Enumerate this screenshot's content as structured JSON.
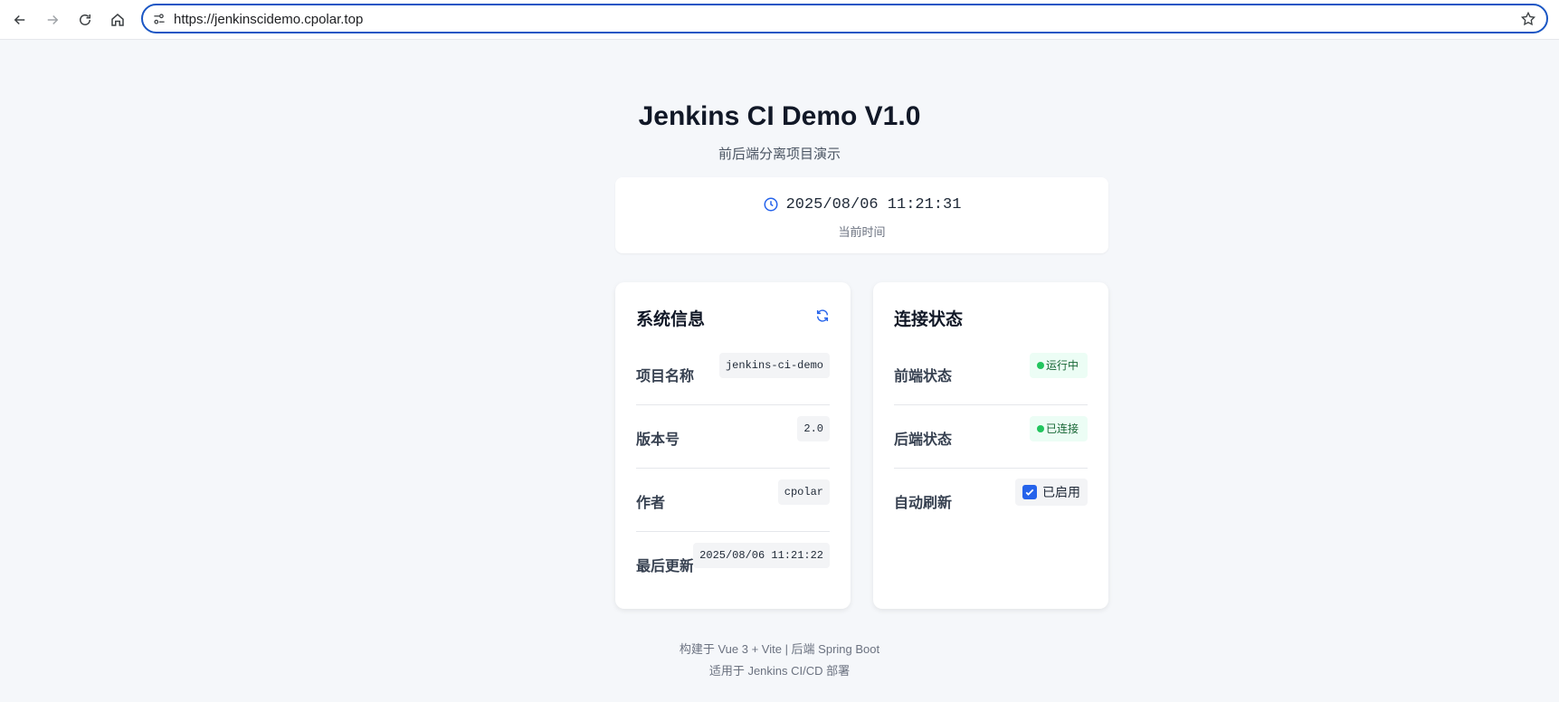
{
  "browser": {
    "url": "https://jenkinscidemo.cpolar.top",
    "icons": [
      "back-icon",
      "forward-icon",
      "reload-icon",
      "home-icon",
      "site-info-icon",
      "bookmark-star-icon"
    ]
  },
  "header": {
    "title": "Jenkins CI Demo V1.0",
    "subtitle": "前后端分离项目演示"
  },
  "clock": {
    "time": "2025/08/06 11:21:31",
    "label": "当前时间",
    "icon": "clock-icon"
  },
  "system_info": {
    "title": "系统信息",
    "refresh_icon": "refresh-icon",
    "rows": [
      {
        "label": "项目名称",
        "value": "jenkins-ci-demo"
      },
      {
        "label": "版本号",
        "value": "2.0"
      },
      {
        "label": "作者",
        "value": "cpolar"
      },
      {
        "label": "最后更新",
        "value": "2025/08/06 11:21:22"
      }
    ]
  },
  "connection": {
    "title": "连接状态",
    "frontend": {
      "label": "前端状态",
      "status": "运行中"
    },
    "backend": {
      "label": "后端状态",
      "status": "已连接"
    },
    "auto_refresh": {
      "label": "自动刷新",
      "status": "已启用",
      "checked": true
    }
  },
  "footer": {
    "line1": "构建于 Vue 3 + Vite | 后端 Spring Boot",
    "line2": "适用于 Jenkins CI/CD 部署"
  },
  "colors": {
    "accent": "#2563eb",
    "status_ok": "#22c55e",
    "background": "#f5f7fa"
  }
}
